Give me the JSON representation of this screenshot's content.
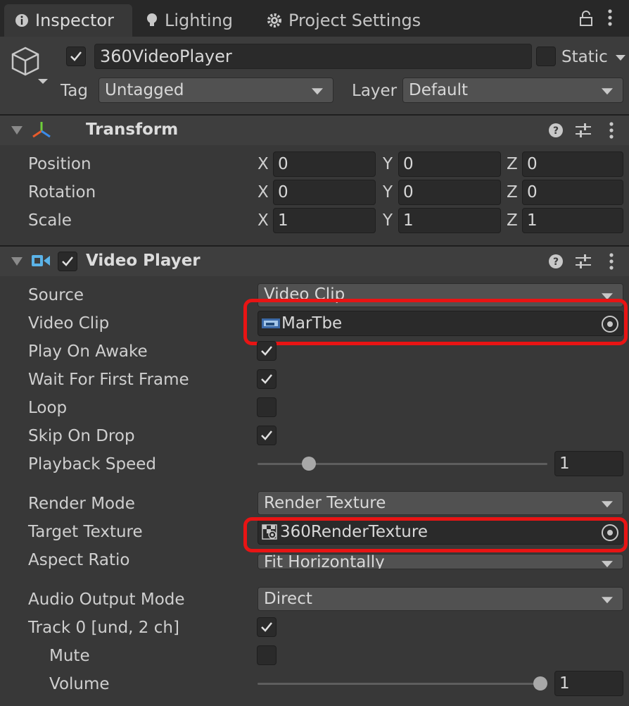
{
  "tabs": [
    {
      "label": "Inspector",
      "icon": "info-icon"
    },
    {
      "label": "Lighting",
      "icon": "lightbulb-icon"
    },
    {
      "label": "Project Settings",
      "icon": "gear-icon"
    }
  ],
  "header": {
    "object_name": "360VideoPlayer",
    "active_checked": true,
    "static_label": "Static",
    "static_checked": false,
    "tag_label": "Tag",
    "tag_value": "Untagged",
    "layer_label": "Layer",
    "layer_value": "Default"
  },
  "transform": {
    "title": "Transform",
    "rows": [
      {
        "label": "Position",
        "x": "0",
        "y": "0",
        "z": "0"
      },
      {
        "label": "Rotation",
        "x": "0",
        "y": "0",
        "z": "0"
      },
      {
        "label": "Scale",
        "x": "1",
        "y": "1",
        "z": "1"
      }
    ],
    "axes": {
      "x": "X",
      "y": "Y",
      "z": "Z"
    }
  },
  "video_player": {
    "title": "Video Player",
    "enabled": true,
    "source_label": "Source",
    "source_value": "Video Clip",
    "video_clip_label": "Video Clip",
    "video_clip_value": "MarTbe",
    "play_on_awake_label": "Play On Awake",
    "play_on_awake": true,
    "wait_first_frame_label": "Wait For First Frame",
    "wait_first_frame": true,
    "loop_label": "Loop",
    "loop": false,
    "skip_on_drop_label": "Skip On Drop",
    "skip_on_drop": true,
    "playback_speed_label": "Playback Speed",
    "playback_speed_value": "1",
    "playback_speed_fraction": 0.16,
    "render_mode_label": "Render Mode",
    "render_mode_value": "Render Texture",
    "target_texture_label": "Target Texture",
    "target_texture_value": "360RenderTexture",
    "aspect_ratio_label": "Aspect Ratio",
    "aspect_ratio_value": "Fit Horizontally",
    "audio_output_label": "Audio Output Mode",
    "audio_output_value": "Direct",
    "track_label": "Track 0 [und, 2 ch]",
    "track_enabled": true,
    "mute_label": "Mute",
    "mute": false,
    "volume_label": "Volume",
    "volume_value": "1",
    "volume_fraction": 1.0
  },
  "colors": {
    "highlight": "#e81414",
    "background": "#383838",
    "field": "#2a2a2a"
  }
}
